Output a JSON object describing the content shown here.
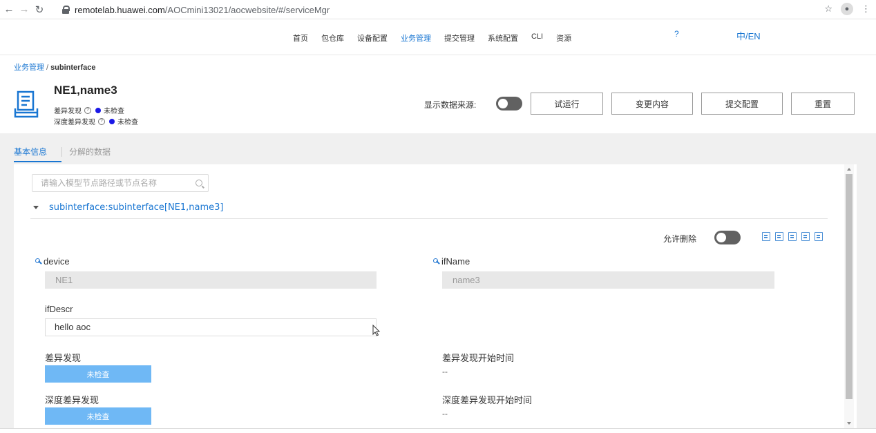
{
  "browser": {
    "url_host": "remotelab.huawei.com",
    "url_path": "/AOCmini13021/aocwebsite/#/serviceMgr",
    "back_icon": "back-arrow-icon",
    "forward_icon": "forward-arrow-icon",
    "reload_icon": "reload-icon"
  },
  "nav": {
    "items": [
      "首页",
      "包仓库",
      "设备配置",
      "业务管理",
      "提交管理",
      "系统配置",
      "CLI",
      "资源"
    ],
    "active_index": 3,
    "help": "?",
    "lang": "中/EN",
    "accent_color": "#1976d2"
  },
  "breadcrumb": {
    "parent": "业务管理",
    "separator": "/",
    "current": "subinterface"
  },
  "object": {
    "title": "NE1,name3",
    "diff_label": "差异发现",
    "diff_status": "未检查",
    "deep_diff_label": "深度差异发现",
    "deep_diff_status": "未检查",
    "status_dot_color": "#1a18e6"
  },
  "toolbar": {
    "show_source_label": "显示数据来源:",
    "trial_run": "试运行",
    "change_content": "变更内容",
    "submit_config": "提交配置",
    "reset": "重置"
  },
  "tabs": {
    "basic": "基本信息",
    "decomposed": "分解的数据"
  },
  "search": {
    "placeholder": "请输入模型节点路径或节点名称"
  },
  "tree": {
    "node_path": "subinterface:subinterface[NE1,name3]"
  },
  "form": {
    "allow_delete_label": "允许删除",
    "device_label": "device",
    "device_value": "NE1",
    "ifname_label": "ifName",
    "ifname_value": "name3",
    "ifdescr_label": "ifDescr",
    "ifdescr_value": "hello aoc",
    "diff_label": "差异发现",
    "diff_button": "未检查",
    "diff_start_label": "差异发现开始时间",
    "diff_start_value": "--",
    "deep_diff_label": "深度差异发现",
    "deep_diff_button": "未检查",
    "deep_diff_start_label": "深度差异发现开始时间",
    "deep_diff_start_value": "--",
    "status_button_color": "#6fb8f5"
  }
}
